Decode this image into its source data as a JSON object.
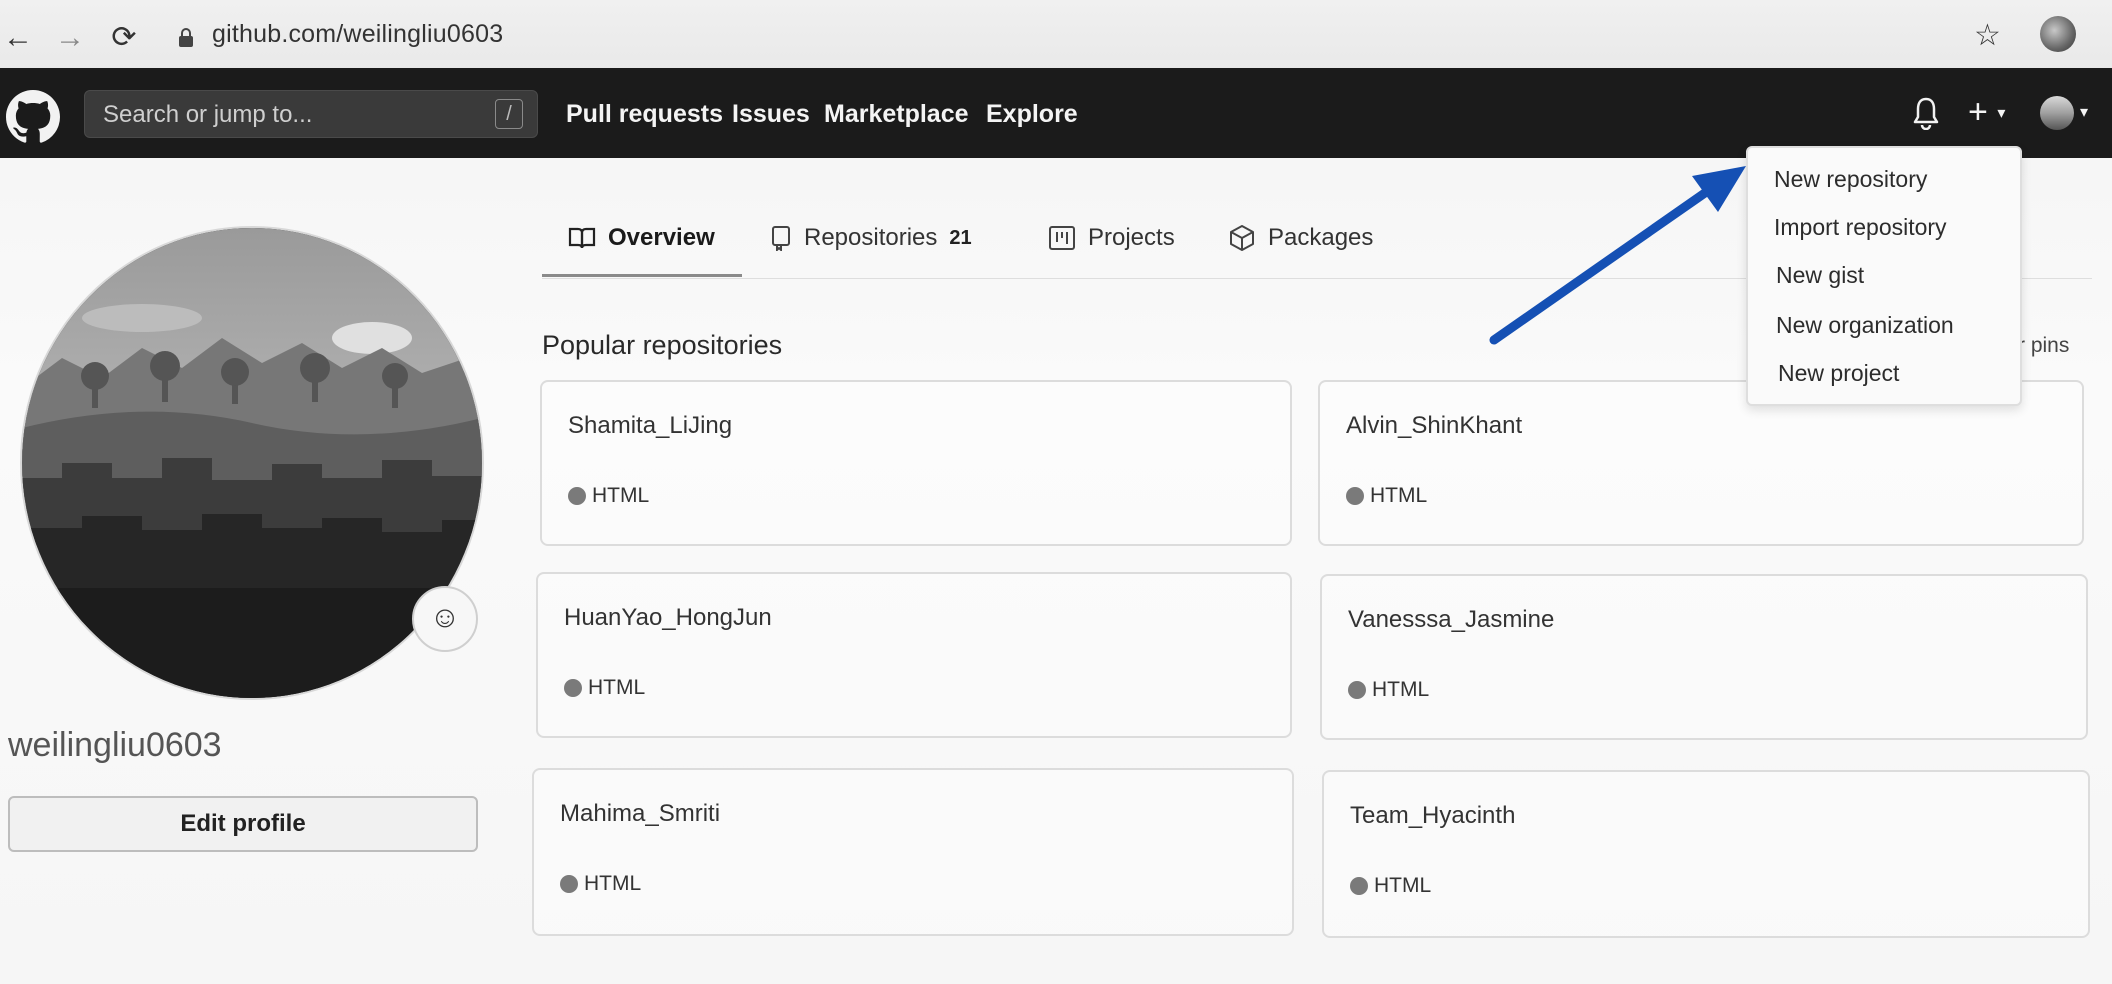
{
  "browser": {
    "url": "github.com/weilingliu0603"
  },
  "header": {
    "search_placeholder": "Search or jump to...",
    "search_shortcut": "/",
    "nav": [
      "Pull requests",
      "Issues",
      "Marketplace",
      "Explore"
    ],
    "new_menu_symbol": "+"
  },
  "profile": {
    "username": "weilingliu0603",
    "edit_label": "Edit profile"
  },
  "tabs": [
    {
      "label": "Overview",
      "icon": "book-icon",
      "active": true
    },
    {
      "label": "Repositories",
      "icon": "repo-icon",
      "count": "21"
    },
    {
      "label": "Projects",
      "icon": "project-icon"
    },
    {
      "label": "Packages",
      "icon": "package-icon"
    }
  ],
  "section": {
    "title": "Popular repositories",
    "customize_partial": "r pins"
  },
  "repos": [
    {
      "name": "Shamita_LiJing",
      "language": "HTML"
    },
    {
      "name": "Alvin_ShinKhant",
      "language": "HTML"
    },
    {
      "name": "HuanYao_HongJun",
      "language": "HTML"
    },
    {
      "name": "Vanesssa_Jasmine",
      "language": "HTML"
    },
    {
      "name": "Mahima_Smriti",
      "language": "HTML"
    },
    {
      "name": "Team_Hyacinth",
      "language": "HTML"
    }
  ],
  "new_menu": {
    "items": [
      "New repository",
      "Import repository",
      "New gist",
      "New organization",
      "New project"
    ]
  },
  "colors": {
    "header_bg": "#1b1b1b",
    "annotation_arrow": "#1550b4"
  }
}
